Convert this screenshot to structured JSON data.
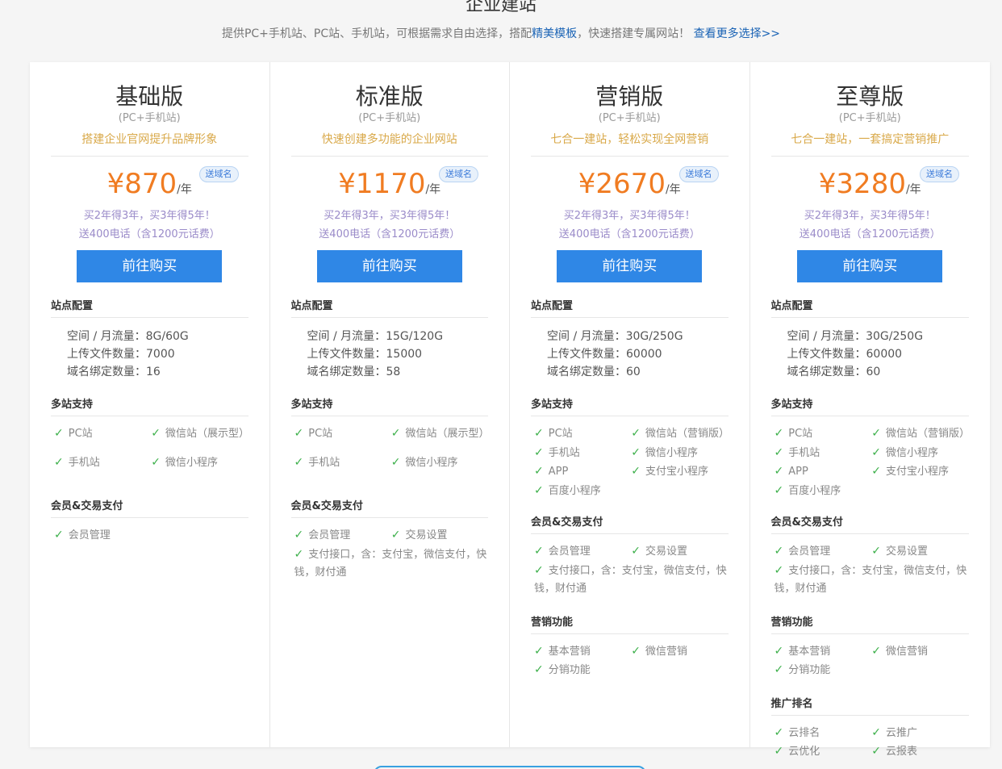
{
  "header": {
    "title": "企业建站",
    "subtitle_pre": "提供PC+手机站、PC站、手机站，可根据需求自由选择，搭配",
    "subtitle_link": "精美模板",
    "subtitle_mid": "，快速搭建专属网站！",
    "subtitle_more": "查看更多选择>>"
  },
  "labels": {
    "site_config": "站点配置",
    "multi_site": "多站支持",
    "member_pay": "会员&交易支付",
    "marketing": "营销功能",
    "ranking": "推广排名",
    "buy": "前往购买",
    "badge": "送域名",
    "unit": "/年",
    "promo1": "买2年得3年，买3年得5年！",
    "promo2": "送400电话（含1200元话费）",
    "check": "✓"
  },
  "plans": [
    {
      "name": "基础版",
      "sub": "(PC+手机站)",
      "slogan": "搭建企业官网提升品牌形象",
      "price": "¥870",
      "config": [
        "空间 / 月流量：8G/60G",
        "上传文件数量：7000",
        "域名绑定数量：16"
      ],
      "multi": [
        "PC站",
        "微信站（展示型）",
        "手机站",
        "微信小程序"
      ],
      "member": [
        "会员管理"
      ]
    },
    {
      "name": "标准版",
      "sub": "(PC+手机站)",
      "slogan": "快速创建多功能的企业网站",
      "price": "¥1170",
      "config": [
        "空间 / 月流量：15G/120G",
        "上传文件数量：15000",
        "域名绑定数量：58"
      ],
      "multi": [
        "PC站",
        "微信站（展示型）",
        "手机站",
        "微信小程序"
      ],
      "member": [
        "会员管理",
        "交易设置"
      ],
      "member_wide": "支付接口，含：支付宝，微信支付，快钱，财付通"
    },
    {
      "name": "营销版",
      "sub": "(PC+手机站)",
      "slogan": "七合一建站，轻松实现全网营销",
      "price": "¥2670",
      "config": [
        "空间 / 月流量：30G/250G",
        "上传文件数量：60000",
        "域名绑定数量：60"
      ],
      "multi": [
        "PC站",
        "微信站（营销版）",
        "手机站",
        "微信小程序",
        "APP",
        "支付宝小程序",
        "百度小程序"
      ],
      "member": [
        "会员管理",
        "交易设置"
      ],
      "member_wide": "支付接口，含：支付宝，微信支付，快钱，财付通",
      "marketing": [
        "基本营销",
        "微信营销",
        "分销功能"
      ]
    },
    {
      "name": "至尊版",
      "sub": "(PC+手机站)",
      "slogan": "七合一建站，一套搞定营销推广",
      "price": "¥3280",
      "config": [
        "空间 / 月流量：30G/250G",
        "上传文件数量：60000",
        "域名绑定数量：60"
      ],
      "multi": [
        "PC站",
        "微信站（营销版）",
        "手机站",
        "微信小程序",
        "APP",
        "支付宝小程序",
        "百度小程序"
      ],
      "member": [
        "会员管理",
        "交易设置"
      ],
      "member_wide": "支付接口，含：支付宝，微信支付，快钱，财付通",
      "marketing": [
        "基本营销",
        "微信营销",
        "分销功能"
      ],
      "ranking": [
        "云排名",
        "云推广",
        "云优化",
        "云报表"
      ]
    }
  ]
}
